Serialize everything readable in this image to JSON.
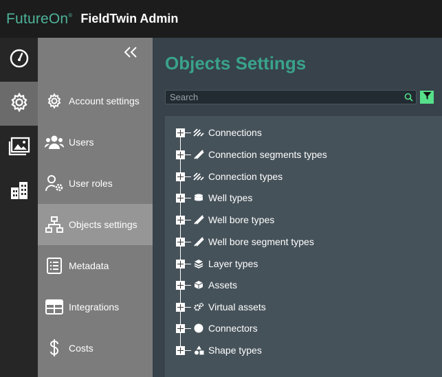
{
  "header": {
    "brand": "FutureOn",
    "brand_mark": "®",
    "app_title": "FieldTwin Admin"
  },
  "rail": [
    {
      "icon": "dashboard-icon",
      "active": false
    },
    {
      "icon": "gear-icon",
      "active": true
    },
    {
      "icon": "gallery-icon",
      "active": false
    },
    {
      "icon": "building-icon",
      "active": false
    }
  ],
  "submenu": {
    "collapse_icon": "double-chevron-left-icon",
    "items": [
      {
        "label": "Account settings",
        "icon": "gear-icon"
      },
      {
        "label": "Users",
        "icon": "users-icon"
      },
      {
        "label": "User roles",
        "icon": "user-cog-icon"
      },
      {
        "label": "Objects settings",
        "icon": "hierarchy-icon"
      },
      {
        "label": "Metadata",
        "icon": "list-icon"
      },
      {
        "label": "Integrations",
        "icon": "table-icon"
      },
      {
        "label": "Costs",
        "icon": "dollar-icon"
      }
    ]
  },
  "main": {
    "title": "Objects Settings",
    "search": {
      "placeholder": "Search",
      "value": ""
    },
    "accent": "#56e08a",
    "tree": [
      {
        "label": "Connections",
        "icon": "connections-icon"
      },
      {
        "label": "Connection segments types",
        "icon": "segment-icon"
      },
      {
        "label": "Connection types",
        "icon": "connections-icon"
      },
      {
        "label": "Well types",
        "icon": "database-icon"
      },
      {
        "label": "Well bore types",
        "icon": "segment-icon"
      },
      {
        "label": "Well bore segment types",
        "icon": "segment-icon"
      },
      {
        "label": "Layer types",
        "icon": "layers-icon"
      },
      {
        "label": "Assets",
        "icon": "cube-icon"
      },
      {
        "label": "Virtual assets",
        "icon": "cogs-icon"
      },
      {
        "label": "Connectors",
        "icon": "circle-icon"
      },
      {
        "label": "Shape types",
        "icon": "shapes-icon"
      }
    ]
  }
}
